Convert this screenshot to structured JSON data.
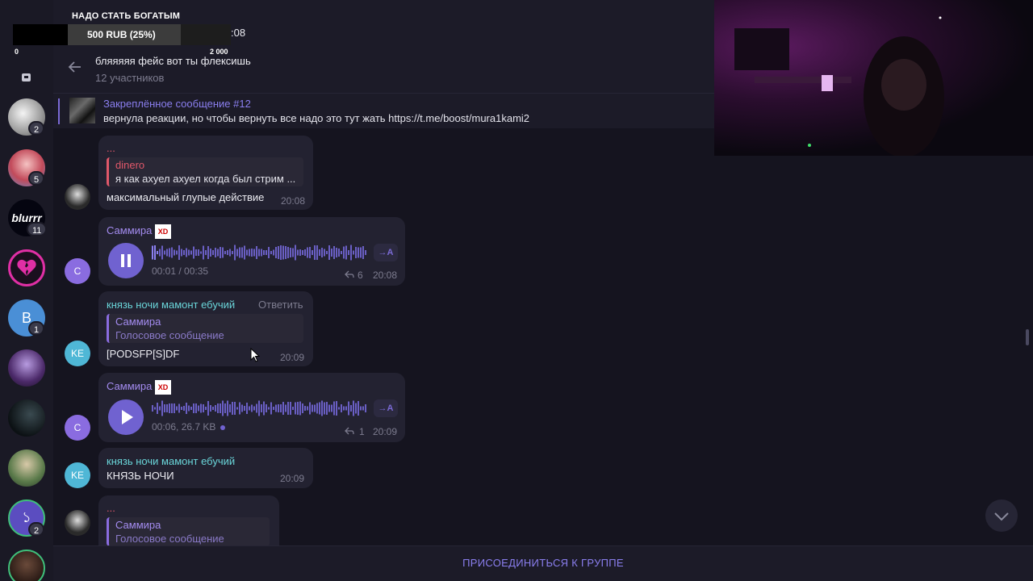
{
  "stream": {
    "goal_title": "НАДО СТАТЬ БОГАТЫМ",
    "goal_label": "500 RUB (25%)",
    "goal_fraction": 0.25,
    "goal_min": "0",
    "goal_max": "2 000",
    "time_fragment": ":08"
  },
  "sidebar": {
    "badges": [
      "2",
      "5",
      "11",
      "1",
      "2"
    ],
    "blurrr_text": "blurrr",
    "letter_avatar": "В",
    "symbol_avatar": "১"
  },
  "header": {
    "title": "бляяяяя фейс вот ты флексишь",
    "subtitle": "12 участников"
  },
  "pinned": {
    "title": "Закреплённое сообщение #12",
    "text": "вернула реакции, но чтобы вернуть все надо это тут жать https://t.me/boost/mura1kami2"
  },
  "messages": {
    "m1": {
      "author": "...",
      "reply_name": "dinero",
      "reply_text": "я как ахуел ахуел когда был стрим ...",
      "text": "максимальный глупые действие",
      "time": "20:08"
    },
    "m2": {
      "author": "Саммира",
      "avatar": "С",
      "voice_time": "00:01 / 00:35",
      "transcribe": "→A",
      "replies": "6",
      "time": "20:08"
    },
    "m3": {
      "author": "князь ночи мамонт ебучий",
      "reply_action": "Ответить",
      "avatar": "KE",
      "reply_name": "Саммира",
      "reply_text": "Голосовое сообщение",
      "text": "[PODSFP[S]DF",
      "time": "20:09"
    },
    "m4": {
      "author": "Саммира",
      "avatar": "С",
      "voice_meta": "00:06, 26.7 KB",
      "transcribe": "→A",
      "replies": "1",
      "time": "20:09"
    },
    "m5": {
      "author": "князь ночи мамонт ебучий",
      "avatar": "KE",
      "text": "КНЯЗЬ НОЧИ",
      "time": "20:09"
    },
    "m6": {
      "author": "...",
      "reply_name": "Саммира",
      "reply_text": "Голосовое сообщение"
    }
  },
  "bottom": {
    "join": "ПРИСОЕДИНИТЬСЯ К ГРУППЕ"
  },
  "colors": {
    "accent": "#8b7ff0",
    "cyan_author": "#6ad5d9",
    "reply_red": "#e0586a",
    "avatar_purple": "#8a6ce0",
    "avatar_cyan": "#4fb7d6"
  }
}
